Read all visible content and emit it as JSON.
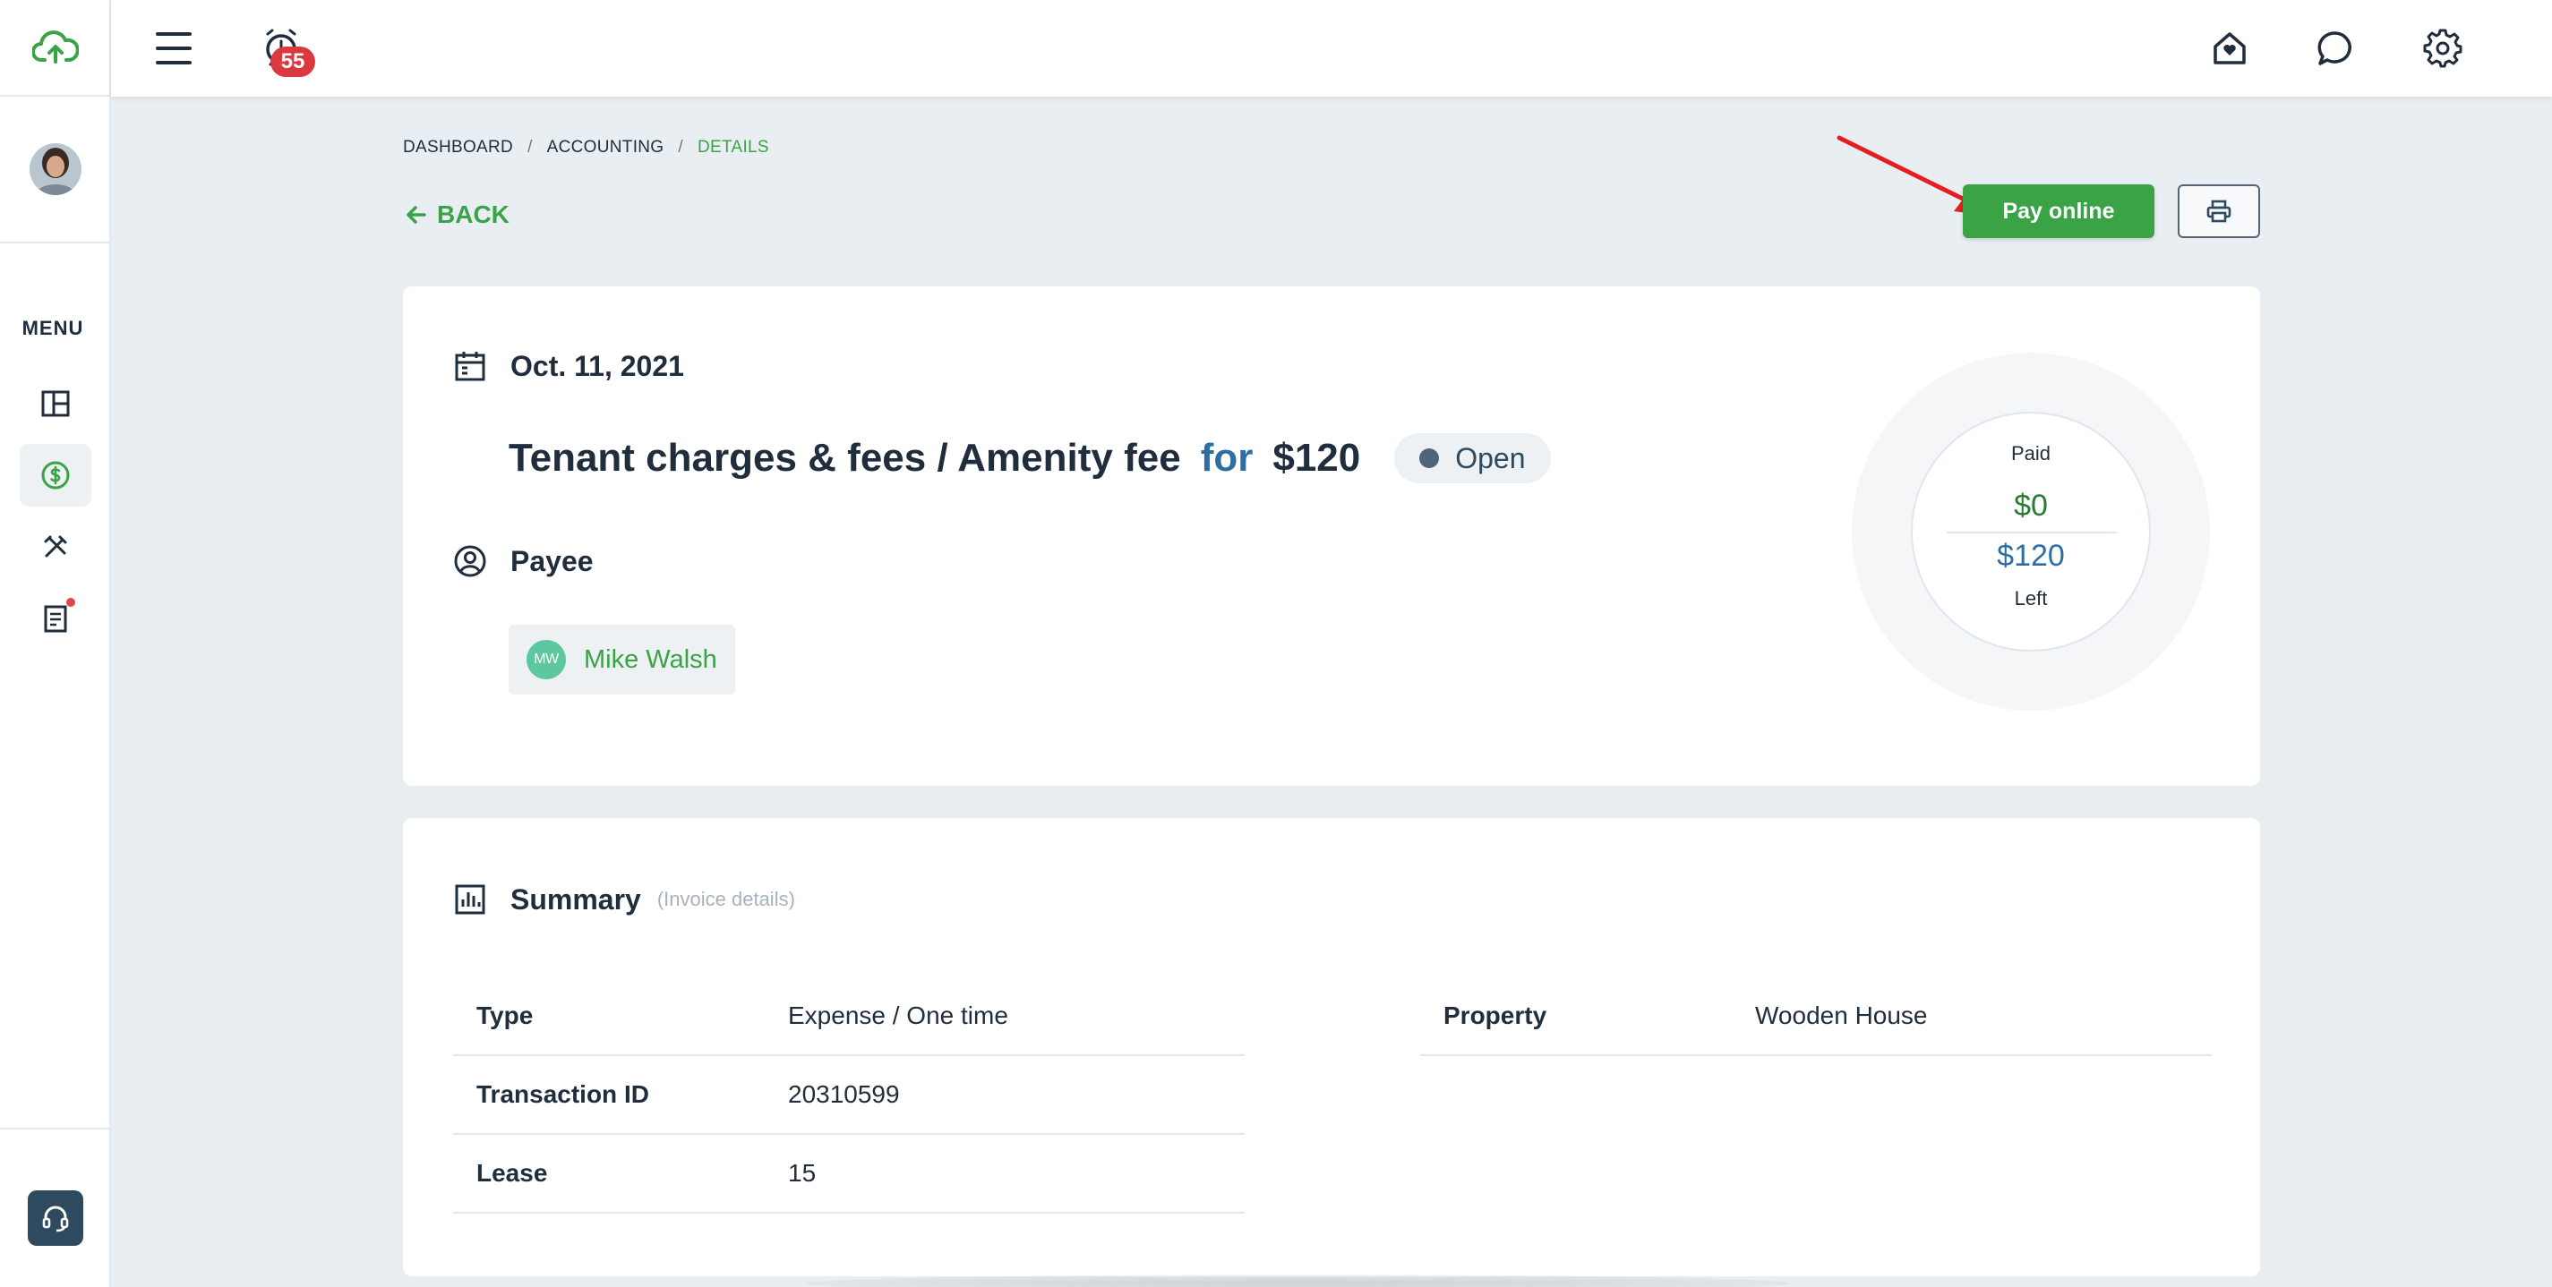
{
  "header": {
    "notification_count": "55",
    "icons": [
      "cloud-upload-icon",
      "menu-icon",
      "alarm-clock-icon",
      "home-heart-icon",
      "chat-bubble-icon",
      "gear-icon"
    ]
  },
  "sidebar": {
    "menu_label": "MENU",
    "items": [
      {
        "name": "dashboard",
        "icon": "layout-grid-icon",
        "active": false
      },
      {
        "name": "accounting",
        "icon": "dollar-circle-icon",
        "active": true
      },
      {
        "name": "maintenance",
        "icon": "tools-icon",
        "active": false
      },
      {
        "name": "documents",
        "icon": "document-icon",
        "active": false,
        "dot": true
      }
    ]
  },
  "breadcrumb": {
    "items": [
      "DASHBOARD",
      "ACCOUNTING",
      "DETAILS"
    ],
    "separator": "/"
  },
  "actions": {
    "back_label": "BACK",
    "pay_label": "Pay online"
  },
  "invoice": {
    "date": "Oct. 11, 2021",
    "title": "Tenant charges & fees / Amenity fee",
    "for_word": "for",
    "amount": "$120",
    "status": "Open",
    "payee_label": "Payee",
    "payee_initials": "MW",
    "payee_name": "Mike Walsh",
    "paid_label": "Paid",
    "paid_amount": "$0",
    "left_amount": "$120",
    "left_label": "Left"
  },
  "summary": {
    "title": "Summary",
    "subtitle": "(Invoice details)",
    "left_rows": [
      {
        "key": "Type",
        "value": "Expense / One time"
      },
      {
        "key": "Transaction ID",
        "value": "20310599"
      },
      {
        "key": "Lease",
        "value": "15"
      }
    ],
    "right_rows": [
      {
        "key": "Property",
        "value": "Wooden House"
      }
    ]
  },
  "colors": {
    "accent_green": "#3aa346",
    "accent_blue": "#2f6ea3",
    "badge_red": "#d9393f"
  }
}
